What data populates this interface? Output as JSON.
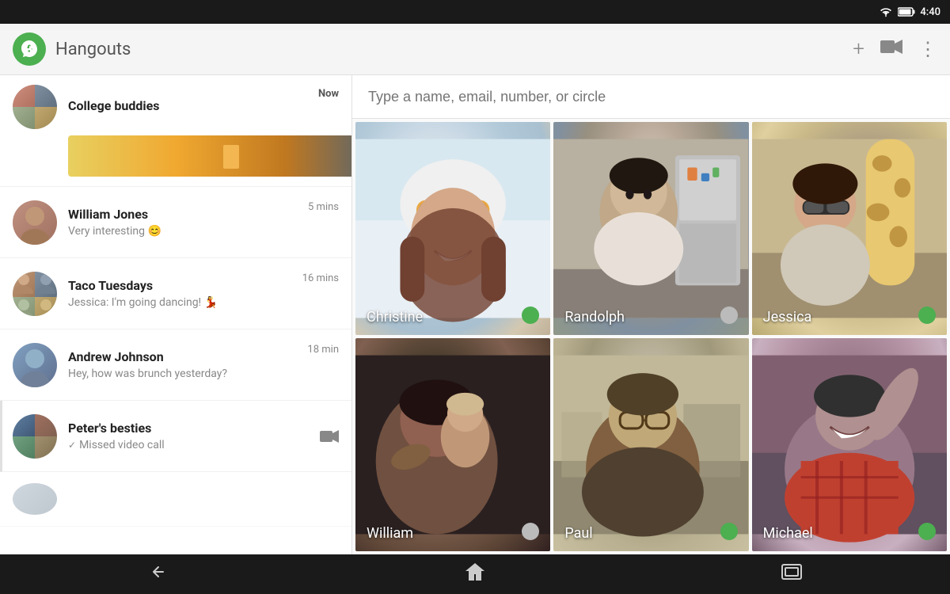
{
  "statusBar": {
    "time": "4:40",
    "wifiIcon": "wifi",
    "batteryIcon": "battery"
  },
  "toolbar": {
    "appName": "Hangouts",
    "addIcon": "+",
    "videoIcon": "▶",
    "moreIcon": "⋮"
  },
  "search": {
    "placeholder": "Type a name, email, number, or circle"
  },
  "conversations": [
    {
      "id": "college-buddies",
      "name": "College buddies",
      "preview": "",
      "time": "Now",
      "timeBold": true,
      "type": "group-banner"
    },
    {
      "id": "william-jones",
      "name": "William Jones",
      "preview": "Very interesting 😊",
      "time": "5 mins",
      "timeBold": false,
      "type": "single"
    },
    {
      "id": "taco-tuesdays",
      "name": "Taco Tuesdays",
      "preview": "Jessica: I'm going dancing! 💃",
      "time": "16 mins",
      "timeBold": false,
      "type": "group"
    },
    {
      "id": "andrew-johnson",
      "name": "Andrew Johnson",
      "preview": "Hey, how was brunch yesterday?",
      "time": "18 min",
      "timeBold": false,
      "type": "single"
    },
    {
      "id": "peters-besties",
      "name": "Peter's besties",
      "preview": "Missed video call",
      "time": "",
      "timeBold": false,
      "type": "group-video"
    }
  ],
  "contacts": [
    {
      "id": "christine",
      "name": "Christine",
      "status": "online",
      "photoClass": "christine-bg"
    },
    {
      "id": "randolph",
      "name": "Randolph",
      "status": "offline",
      "photoClass": "randolph-bg"
    },
    {
      "id": "jessica",
      "name": "Jessica",
      "status": "online",
      "photoClass": "jessica-bg"
    },
    {
      "id": "william",
      "name": "William",
      "status": "offline",
      "photoClass": "william-bg"
    },
    {
      "id": "paul",
      "name": "Paul",
      "status": "online",
      "photoClass": "paul-bg"
    },
    {
      "id": "michael",
      "name": "Michael",
      "status": "online",
      "photoClass": "michael-bg"
    }
  ],
  "navBar": {
    "backIcon": "←",
    "homeIcon": "⌂",
    "recentsIcon": "▭"
  }
}
